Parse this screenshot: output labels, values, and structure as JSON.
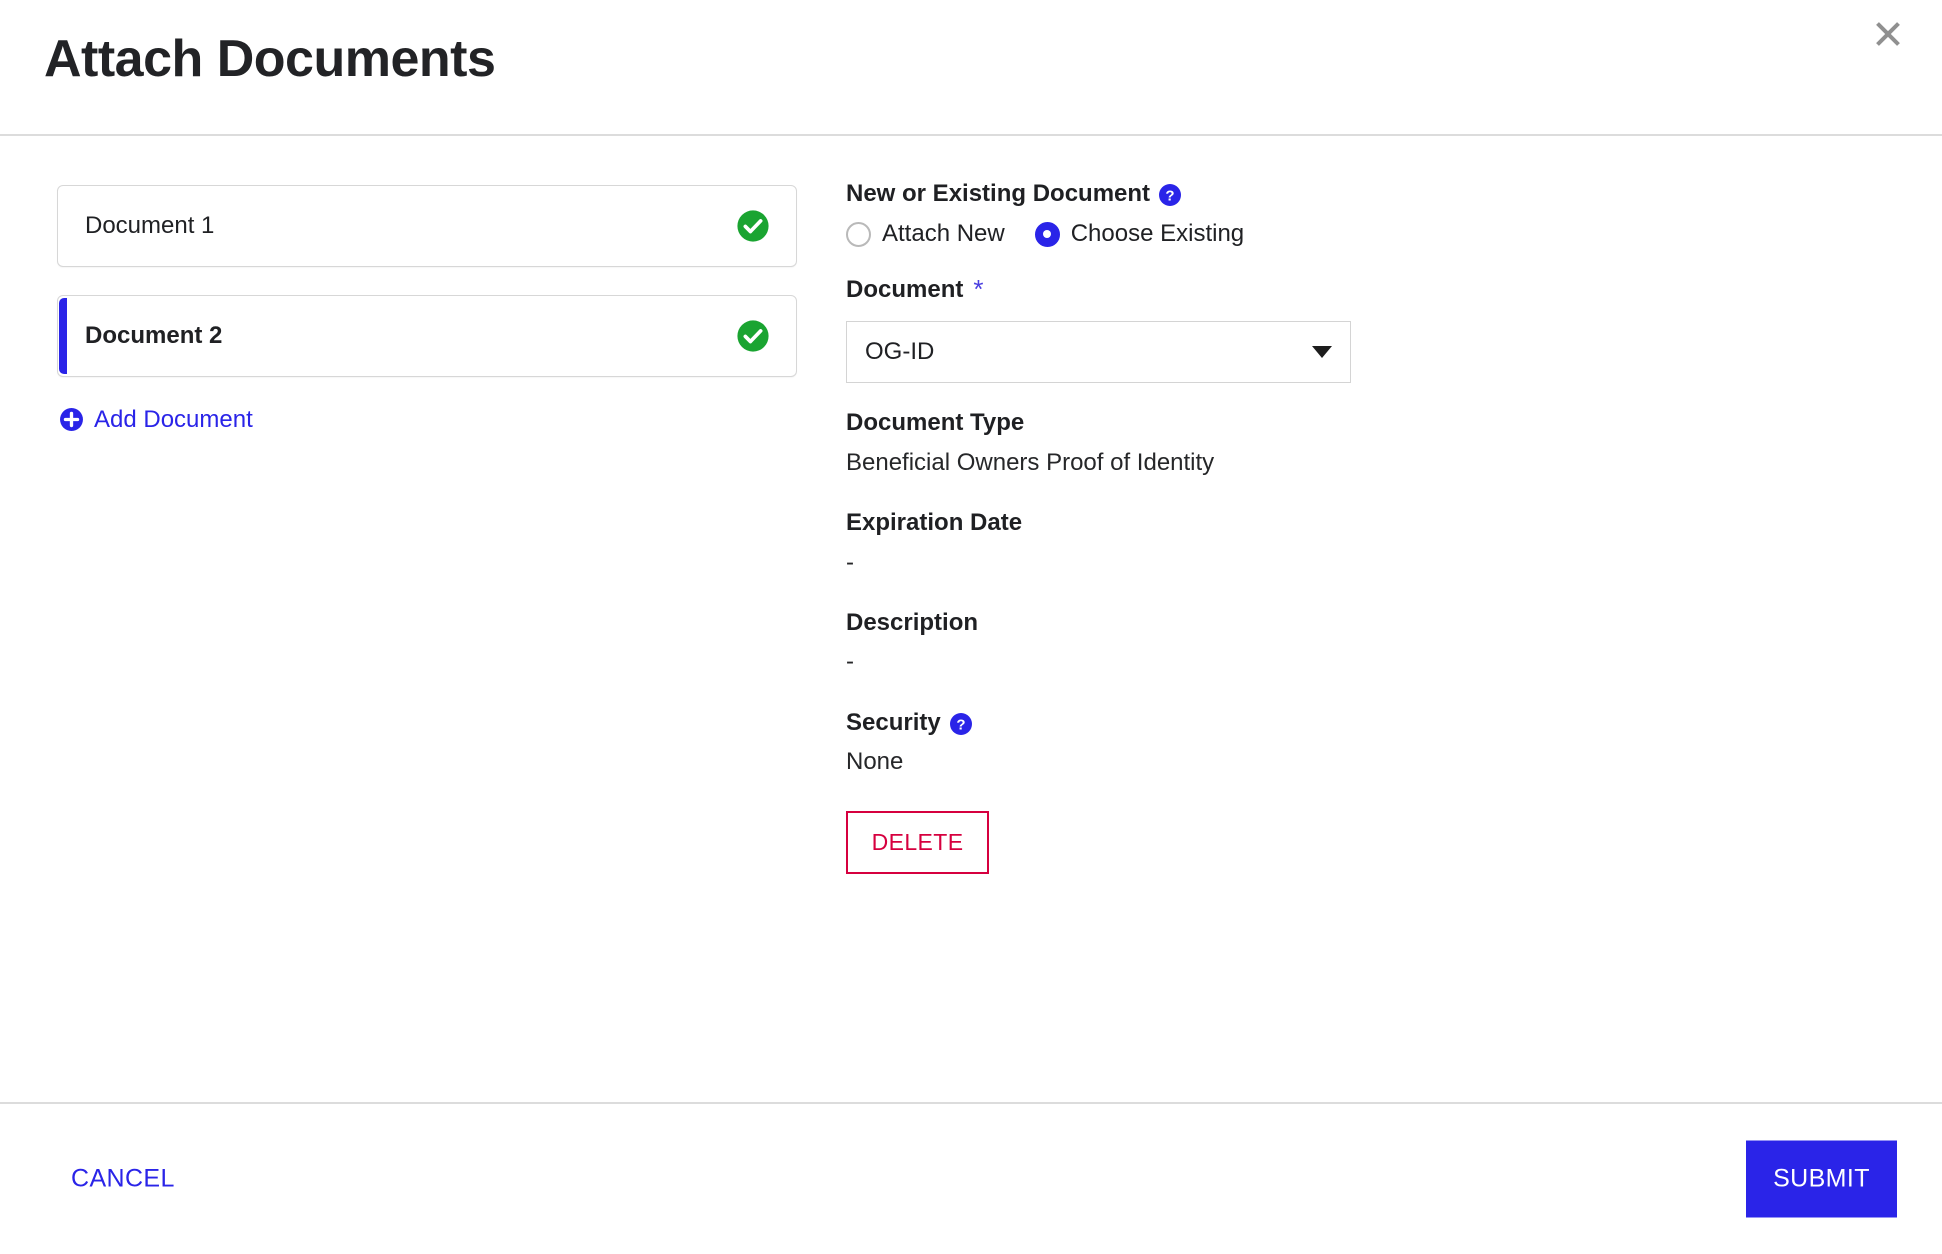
{
  "dialog": {
    "title": "Attach Documents",
    "close_icon": "close-icon"
  },
  "document_list": {
    "items": [
      {
        "label": "Document 1",
        "status_icon": "check-circle-icon",
        "selected": false
      },
      {
        "label": "Document 2",
        "status_icon": "check-circle-icon",
        "selected": true
      }
    ],
    "add_label": "Add Document",
    "add_icon": "plus-circle-icon"
  },
  "detail": {
    "mode_label": "New or Existing Document",
    "mode_help_icon": "help-circle-icon",
    "radio_attach_new": "Attach New",
    "radio_choose_existing": "Choose Existing",
    "selected_mode": "Choose Existing",
    "document_label": "Document",
    "document_required_mark": "*",
    "document_value": "OG-ID",
    "document_caret_icon": "chevron-down-icon",
    "document_type_label": "Document Type",
    "document_type_value": "Beneficial Owners Proof of Identity",
    "expiration_label": "Expiration Date",
    "expiration_value": "-",
    "description_label": "Description",
    "description_value": "-",
    "security_label": "Security",
    "security_help_icon": "help-circle-icon",
    "security_value": "None",
    "delete_label": "DELETE"
  },
  "footer": {
    "cancel_label": "CANCEL",
    "submit_label": "SUBMIT"
  },
  "colors": {
    "accent_blue": "#2a24e8",
    "success_green": "#1aa431",
    "danger_red": "#d6003f",
    "border_gray": "#dcdcdc"
  }
}
